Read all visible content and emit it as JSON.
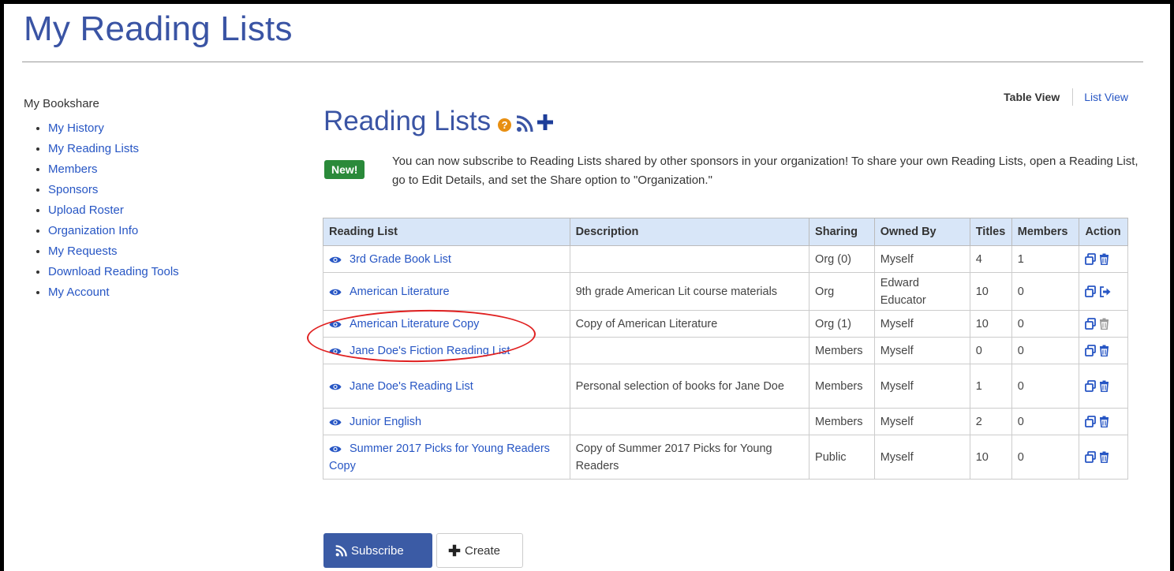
{
  "page": {
    "title": "My Reading Lists"
  },
  "sidebar": {
    "heading": "My Bookshare",
    "items": [
      {
        "label": "My History"
      },
      {
        "label": "My Reading Lists"
      },
      {
        "label": "Members"
      },
      {
        "label": "Sponsors"
      },
      {
        "label": "Upload Roster"
      },
      {
        "label": "Organization Info"
      },
      {
        "label": "My Requests"
      },
      {
        "label": "Download Reading Tools"
      },
      {
        "label": "My Account"
      }
    ]
  },
  "view_switch": {
    "table_view": "Table View",
    "list_view": "List View"
  },
  "reading_lists": {
    "heading": "Reading Lists",
    "new_badge": "New!",
    "notice": "You can now subscribe to Reading Lists shared by other sponsors in your organization! To share your own Reading Lists, open a Reading List, go to Edit Details, and set the Share option to \"Organization.\""
  },
  "table": {
    "headers": {
      "reading_list": "Reading List",
      "description": "Description",
      "sharing": "Sharing",
      "owned_by": "Owned By",
      "titles": "Titles",
      "members": "Members",
      "action": "Action"
    },
    "rows": [
      {
        "name": "3rd Grade Book List",
        "description": "",
        "sharing": "Org (0)",
        "owner": "Myself",
        "titles": "4",
        "members": "1",
        "action": "copy-delete"
      },
      {
        "name": "American Literature",
        "description": "9th grade American Lit course materials",
        "sharing": "Org",
        "owner": "Edward Educator",
        "titles": "10",
        "members": "0",
        "action": "copy-unsubscribe"
      },
      {
        "name": "American Literature Copy",
        "description": "Copy of American Literature",
        "sharing": "Org (1)",
        "owner": "Myself",
        "titles": "10",
        "members": "0",
        "action": "copy-delete-disabled"
      },
      {
        "name": "Jane Doe's Fiction Reading List",
        "description": "",
        "sharing": "Members",
        "owner": "Myself",
        "titles": "0",
        "members": "0",
        "action": "copy-delete"
      },
      {
        "name": "Jane Doe's Reading List",
        "description": "Personal selection of books for Jane Doe",
        "sharing": "Members",
        "owner": "Myself",
        "titles": "1",
        "members": "0",
        "action": "copy-delete"
      },
      {
        "name": "Junior English",
        "description": "",
        "sharing": "Members",
        "owner": "Myself",
        "titles": "2",
        "members": "0",
        "action": "copy-delete"
      },
      {
        "name": "Summer 2017 Picks for Young Readers Copy",
        "description": "Copy of Summer 2017 Picks for Young Readers",
        "sharing": "Public",
        "owner": "Myself",
        "titles": "10",
        "members": "0",
        "action": "copy-delete"
      }
    ]
  },
  "buttons": {
    "subscribe": "Subscribe",
    "create": "Create"
  },
  "icons": {
    "eye": "eye-icon",
    "copy": "copy-icon",
    "delete": "trash-icon",
    "unsubscribe": "sign-out-icon",
    "rss": "rss-icon",
    "plus": "plus-icon",
    "help": "question-icon"
  },
  "colors": {
    "title": "#3a54a4",
    "link": "#2756c4",
    "header_bg": "#d8e6f8",
    "badge_green": "#2a8a3a",
    "help_orange": "#e88f12",
    "subscribe_bg": "#3b5ba5",
    "annotation_red": "#e02020"
  }
}
